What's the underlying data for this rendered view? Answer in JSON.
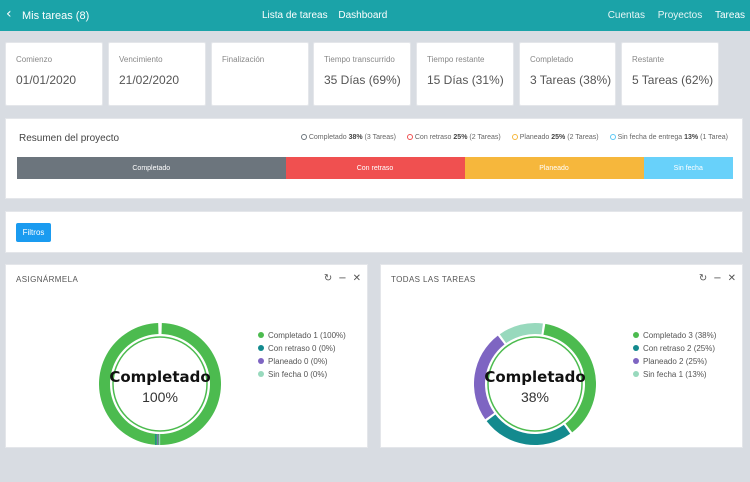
{
  "topbar": {
    "back_icon": "chevron-left-icon",
    "title": "Mis tareas (8)",
    "nav": [
      "Lista de tareas",
      "Dashboard"
    ],
    "right_nav": [
      "Cuentas",
      "Proyectos",
      "Tareas"
    ]
  },
  "stats": [
    {
      "label": "Comienzo",
      "value": "01/01/2020"
    },
    {
      "label": "Vencimiento",
      "value": "21/02/2020"
    },
    {
      "label": "Finalización",
      "value": ""
    },
    {
      "label": "Tiempo transcurrido",
      "value": "35 Días (69%)"
    },
    {
      "label": "Tiempo restante",
      "value": "15 Días (31%)"
    },
    {
      "label": "Completado",
      "value": "3 Tareas (38%)"
    },
    {
      "label": "Restante",
      "value": "5 Tareas (62%)"
    }
  ],
  "summary": {
    "title": "Resumen del proyecto",
    "legend": [
      {
        "name": "Completado",
        "pct": "38%",
        "count": "(3 Tareas)",
        "color": "#6c757d"
      },
      {
        "name": "Con retraso",
        "pct": "25%",
        "count": "(2 Tareas)",
        "color": "#f05050"
      },
      {
        "name": "Planeado",
        "pct": "25%",
        "count": "(2 Tareas)",
        "color": "#f6b73c"
      },
      {
        "name": "Sin fecha de entrega",
        "pct": "13%",
        "count": "(1 Tarea)",
        "color": "#5bc8f5"
      }
    ],
    "bar": [
      {
        "label": "Completado",
        "share": 0.375,
        "color": "#6c757d"
      },
      {
        "label": "Con retraso",
        "share": 0.25,
        "color": "#f05050"
      },
      {
        "label": "Planeado",
        "share": 0.25,
        "color": "#f6b73c"
      },
      {
        "label": "Sin fecha",
        "share": 0.125,
        "color": "#68d1fa"
      }
    ]
  },
  "filters": {
    "button_label": "Filtros"
  },
  "panels": [
    {
      "title": "ASIGNÁRMELA",
      "tool_icons": [
        "refresh-icon",
        "minimize-icon",
        "close-icon"
      ],
      "center_label": "Completado",
      "center_value": "100%",
      "legend": [
        {
          "text": "Completado 1 (100%)",
          "color": "#4cbb4f"
        },
        {
          "text": "Con retraso 0 (0%)",
          "color": "#138a8e"
        },
        {
          "text": "Planeado 0 (0%)",
          "color": "#7e65c2"
        },
        {
          "text": "Sin fecha 0 (0%)",
          "color": "#98d9bd"
        }
      ]
    },
    {
      "title": "TODAS LAS TAREAS",
      "tool_icons": [
        "refresh-icon",
        "minimize-icon",
        "close-icon"
      ],
      "center_label": "Completado",
      "center_value": "38%",
      "legend": [
        {
          "text": "Completado 3 (38%)",
          "color": "#4cbb4f"
        },
        {
          "text": "Con retraso 2 (25%)",
          "color": "#138a8e"
        },
        {
          "text": "Planeado 2 (25%)",
          "color": "#7e65c2"
        },
        {
          "text": "Sin fecha 1 (13%)",
          "color": "#98d9bd"
        }
      ]
    }
  ],
  "chart_data": [
    {
      "type": "pie",
      "categories": [
        "Completado",
        "Con retraso",
        "Planeado",
        "Sin fecha"
      ],
      "values": [
        1,
        0,
        0,
        0
      ],
      "title": "ASIGNÁRMELA",
      "legend": "right"
    },
    {
      "type": "pie",
      "categories": [
        "Completado",
        "Con retraso",
        "Planeado",
        "Sin fecha"
      ],
      "values": [
        3,
        2,
        2,
        1
      ],
      "title": "TODAS LAS TAREAS",
      "legend": "right"
    }
  ]
}
